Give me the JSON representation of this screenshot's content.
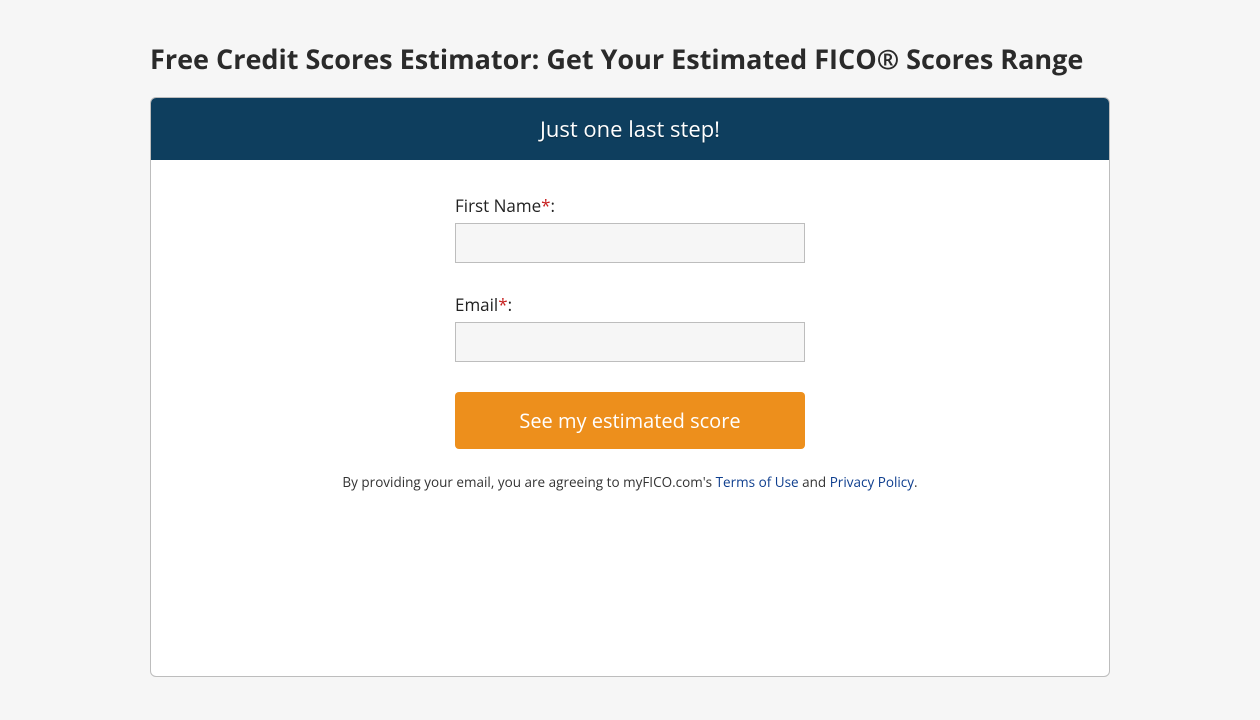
{
  "page": {
    "title": "Free Credit Scores Estimator: Get Your Estimated FICO® Scores Range"
  },
  "card": {
    "header": "Just one last step!"
  },
  "form": {
    "first_name": {
      "label": "First Name",
      "required_marker": "*",
      "after": ":",
      "value": ""
    },
    "email": {
      "label": "Email",
      "required_marker": "*",
      "after": ":",
      "value": ""
    },
    "submit_label": "See my estimated score"
  },
  "disclaimer": {
    "prefix": "By providing your email, you are agreeing to myFICO.com's ",
    "terms_label": "Terms of Use",
    "middle": " and ",
    "privacy_label": "Privacy Policy",
    "suffix": "."
  }
}
